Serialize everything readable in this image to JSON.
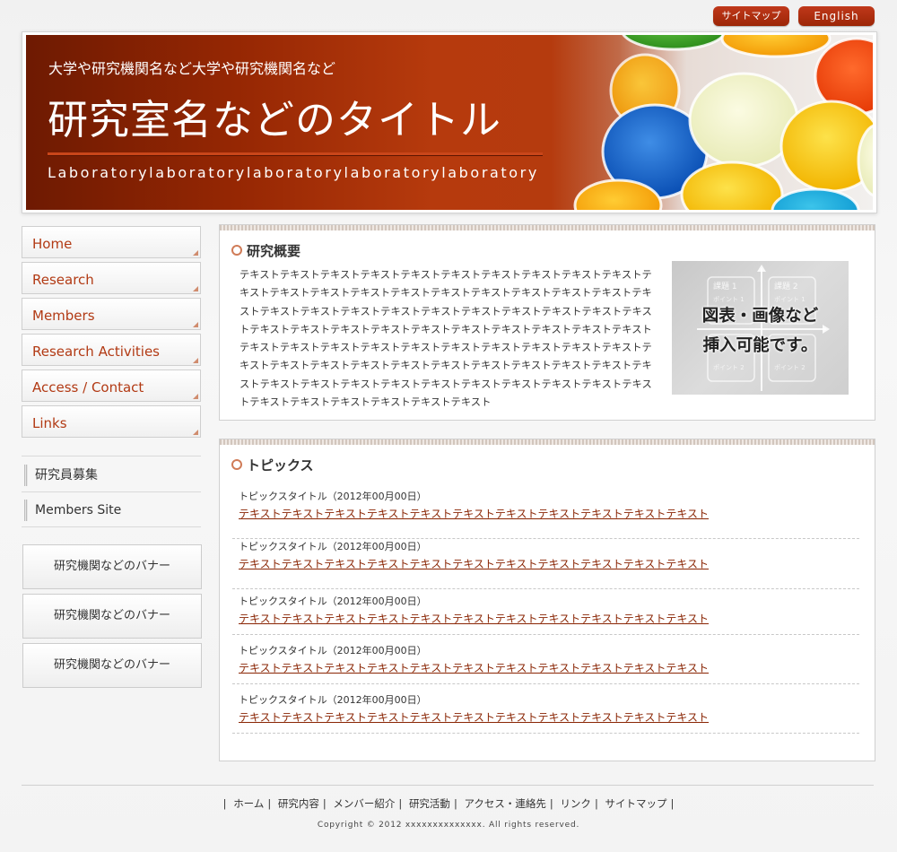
{
  "top_buttons": {
    "sitemap": "サイトマップ",
    "english": "English"
  },
  "header": {
    "subtitle": "大学や研究機関名など大学や研究機関名など",
    "title": "研究室名などのタイトル",
    "english": "Laboratorylaboratorylaboratorylaboratorylaboratory"
  },
  "nav": [
    {
      "label": "Home"
    },
    {
      "label": "Research"
    },
    {
      "label": "Members"
    },
    {
      "label": "Research Activities"
    },
    {
      "label": "Access / Contact"
    },
    {
      "label": "Links"
    }
  ],
  "sub_links": [
    {
      "label": "研究員募集"
    },
    {
      "label": "Members Site"
    }
  ],
  "banners": [
    {
      "label": "研究機関などのバナー"
    },
    {
      "label": "研究機関などのバナー"
    },
    {
      "label": "研究機関などのバナー"
    }
  ],
  "research": {
    "heading": "研究概要",
    "body": "テキストテキストテキストテキストテキストテキストテキストテキストテキストテキストテキストテキストテキストテキストテキストテキストテキストテキストテキストテキストテキストテキストテキストテキストテキストテキストテキストテキストテキストテキストテキストテキストテキストテキストテキストテキストテキストテキストテキストテキストテキストテキストテキストテキストテキストテキストテキストテキストテキストテキストテキストテキストテキストテキストテキストテキストテキストテキストテキストテキストテキストテキストテキストテキストテキストテキストテキストテキストテキストテキストテキストテキストテキストテキストテキストテキストテキストテキスト",
    "figure": {
      "label_line1": "図表・画像など",
      "label_line2": "挿入可能です。",
      "task1": "課題 1",
      "task2": "課題 2",
      "point1": "ポイント 1",
      "point2": "ポイント 2"
    }
  },
  "topics": {
    "heading": "トピックス",
    "items": [
      {
        "title": "トピックスタイトル（2012年00月00日）",
        "link": "テキストテキストテキストテキストテキストテキストテキストテキストテキストテキストテキスト"
      },
      {
        "title": "トピックスタイトル（2012年00月00日）",
        "link": "テキストテキストテキストテキストテキストテキストテキストテキストテキストテキストテキスト"
      },
      {
        "title": "トピックスタイトル（2012年00月00日）",
        "link": "テキストテキストテキストテキストテキストテキストテキストテキストテキストテキストテキスト"
      },
      {
        "title": "トピックスタイトル（2012年00月00日）",
        "link": "テキストテキストテキストテキストテキストテキストテキストテキストテキストテキストテキスト"
      },
      {
        "title": "トピックスタイトル（2012年00月00日）",
        "link": "テキストテキストテキストテキストテキストテキストテキストテキストテキストテキストテキスト"
      }
    ]
  },
  "footer": {
    "nav": [
      "ホーム",
      "研究内容",
      "メンバー紹介",
      "研究活動",
      "アクセス・連絡先",
      "リンク",
      "サイトマップ"
    ],
    "separator": "|",
    "copyright": "Copyright © 2012 xxxxxxxxxxxxxx. All rights reserved."
  },
  "colors": {
    "accent": "#a82e0a",
    "link": "#8a2605",
    "nav_text": "#b23a14"
  }
}
